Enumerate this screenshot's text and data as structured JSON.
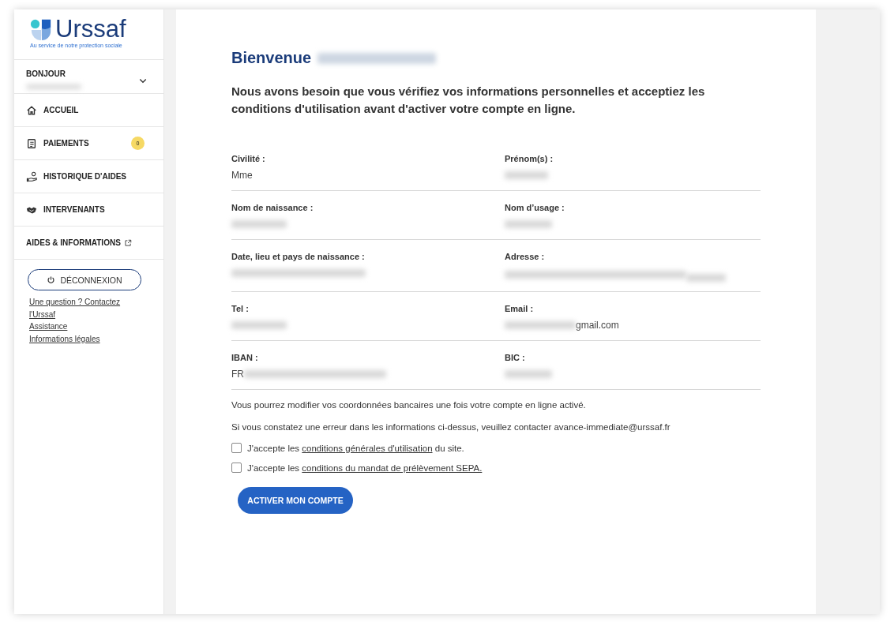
{
  "sidebar": {
    "logo": {
      "name": "Urssaf",
      "tagline": "Au service de notre protection sociale"
    },
    "user": {
      "greeting": "BONJOUR",
      "name_redacted": true,
      "expanded": false
    },
    "items": [
      {
        "label": "ACCUEIL",
        "kind": "home",
        "selected": false
      },
      {
        "label": "PAIEMENTS",
        "kind": "document",
        "selected": false,
        "badge": "0"
      },
      {
        "label": "HISTORIQUE D'AIDES",
        "kind": "hand",
        "selected": false
      },
      {
        "label": "INTERVENANTS",
        "kind": "handshake",
        "selected": false
      },
      {
        "label": "AIDES & INFORMATIONS",
        "kind": "external",
        "selected": false
      }
    ],
    "logout": "DÉCONNEXION",
    "links": [
      "Une question ? Contactez l'Urssaf",
      "Assistance",
      "Informations légales"
    ]
  },
  "main": {
    "title": "Bienvenue",
    "title_name_redacted": true,
    "intro": "Nous avons besoin que vous vérifiez vos informations personnelles et acceptiez les conditions d'utilisation avant d'activer votre compte en ligne.",
    "fields": [
      {
        "label": "Civilité :",
        "value": [
          {
            "kind": "text",
            "text": "Mme"
          }
        ]
      },
      {
        "label": "Prénom(s) :",
        "value": [
          {
            "kind": "blur"
          }
        ]
      },
      {
        "label": "Nom de naissance :",
        "value": [
          {
            "kind": "blur"
          }
        ]
      },
      {
        "label": "Nom d’usage :",
        "value": [
          {
            "kind": "blur"
          }
        ]
      },
      {
        "label": "Date, lieu et pays de naissance :",
        "value": [
          {
            "kind": "blur"
          }
        ]
      },
      {
        "label": "Adresse :",
        "value": [
          {
            "kind": "blur"
          },
          {
            "kind": "blur"
          }
        ]
      },
      {
        "label": "Tel :",
        "value": [
          {
            "kind": "blur"
          }
        ]
      },
      {
        "label": "Email :",
        "value": [
          {
            "kind": "blur"
          },
          {
            "kind": "text",
            "text": "gmail.com"
          }
        ]
      },
      {
        "label": "IBAN :",
        "value": [
          {
            "kind": "text",
            "text": "FR"
          },
          {
            "kind": "blur"
          }
        ]
      },
      {
        "label": "BIC :",
        "value": [
          {
            "kind": "blur"
          }
        ]
      }
    ],
    "notes": [
      "Vous pourrez modifier vos coordonnées bancaires une fois votre compte en ligne activé.",
      "Si vous constatez une erreur dans les informations ci-dessus, veuillez contacter avance-immediate@urssaf.fr"
    ],
    "checkboxes": [
      {
        "before": "J'accepte les",
        "link": "conditions générales d'utilisation",
        "after": "du site.",
        "checked": false
      },
      {
        "before": "J'accepte les",
        "link": "conditions du mandat de prélèvement SEPA.",
        "checked": false
      }
    ],
    "button": "ACTIVER MON COMPTE"
  }
}
